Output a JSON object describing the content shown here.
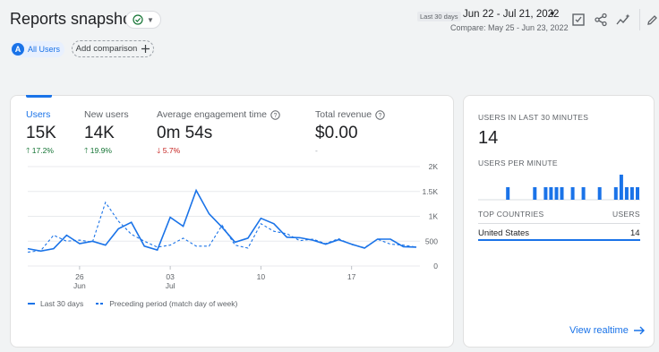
{
  "header": {
    "title": "Reports snapshot",
    "date_badge": "Last 30 days",
    "date_range": "Jun 22 - Jul 21, 2022",
    "compare": "Compare: May 25 - Jun 23, 2022"
  },
  "comparisons": {
    "avatar": "A",
    "active_label": "All Users",
    "add_label": "Add comparison"
  },
  "metrics": [
    {
      "label": "Users",
      "value": "15K",
      "change": "17.2%",
      "dir": "up"
    },
    {
      "label": "New users",
      "value": "14K",
      "change": "19.9%",
      "dir": "up"
    },
    {
      "label": "Average engagement time",
      "value": "0m 54s",
      "change": "5.7%",
      "dir": "down"
    },
    {
      "label": "Total revenue",
      "value": "$0.00",
      "change": "-",
      "dir": "none"
    }
  ],
  "chart_data": {
    "type": "line",
    "x_ticks": [
      {
        "day": "26",
        "month": "Jun",
        "index": 4
      },
      {
        "day": "03",
        "month": "Jul",
        "index": 11
      },
      {
        "day": "10",
        "month": "",
        "index": 18
      },
      {
        "day": "17",
        "month": "",
        "index": 25
      }
    ],
    "y_ticks": [
      "2K",
      "1.5K",
      "1K",
      "500",
      "0"
    ],
    "ylim": [
      0,
      2000
    ],
    "series": [
      {
        "name": "Last 30 days",
        "style": "solid",
        "values": [
          350,
          300,
          350,
          620,
          450,
          500,
          420,
          750,
          880,
          400,
          320,
          980,
          800,
          1520,
          1050,
          780,
          480,
          560,
          960,
          850,
          580,
          570,
          520,
          440,
          530,
          440,
          360,
          540,
          540,
          390,
          380
        ]
      },
      {
        "name": "Preceding period (match day of week)",
        "style": "dashed",
        "values": [
          280,
          310,
          620,
          500,
          520,
          480,
          1280,
          900,
          640,
          500,
          380,
          420,
          560,
          400,
          400,
          820,
          420,
          360,
          850,
          700,
          650,
          510,
          540,
          450,
          550,
          430,
          370,
          540,
          440,
          420,
          380
        ]
      }
    ],
    "colors": {
      "line": "#1a73e8"
    }
  },
  "realtime": {
    "users_label": "USERS IN LAST 30 MINUTES",
    "users_value": "14",
    "per_minute_label": "USERS PER MINUTE",
    "per_minute_bars": [
      0,
      0,
      0,
      0,
      0,
      1,
      0,
      0,
      0,
      0,
      1,
      0,
      1,
      1,
      1,
      1,
      0,
      1,
      0,
      1,
      0,
      0,
      1,
      0,
      0,
      1,
      2,
      1,
      1,
      1
    ],
    "countries_label": "TOP COUNTRIES",
    "users_col": "USERS",
    "rows": [
      {
        "country": "United States",
        "users": "14"
      }
    ],
    "view_link": "View realtime"
  }
}
